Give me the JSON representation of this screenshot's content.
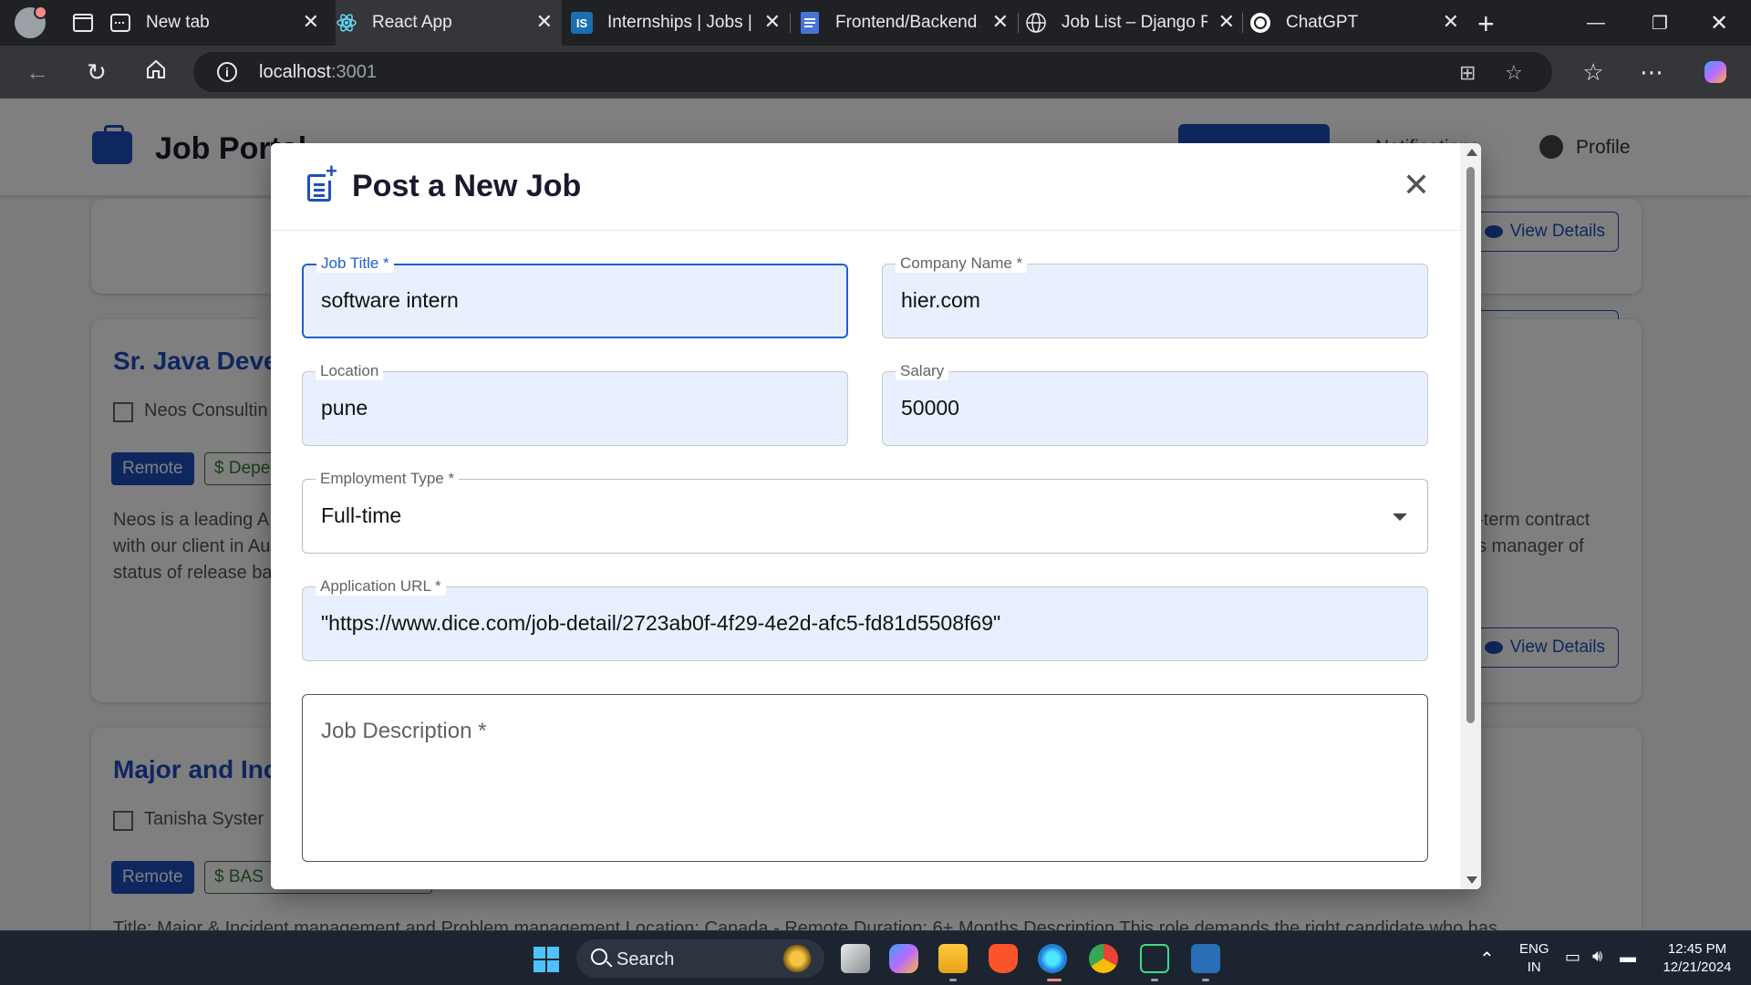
{
  "browser": {
    "tabs": [
      {
        "title": "New tab",
        "icon": "new-tab-icon"
      },
      {
        "title": "React App",
        "icon": "react-icon"
      },
      {
        "title": "Internships | Jobs | T",
        "icon": "internshala-icon"
      },
      {
        "title": "Frontend/Backend A",
        "icon": "docs-icon"
      },
      {
        "title": "Job List – Django RE",
        "icon": "globe-icon"
      },
      {
        "title": "ChatGPT",
        "icon": "chatgpt-icon"
      }
    ],
    "url_host": "localhost",
    "url_port": ":3001",
    "icon_letters": "IS"
  },
  "app": {
    "brand": "Job Portal",
    "header_links": [
      "Notifications",
      "Profile"
    ]
  },
  "cards": [
    {
      "title": "Sr. Java Deve",
      "company": "Neos Consultin",
      "chip_remote": "Remote",
      "chip_salary": "$ Depe",
      "desc_left": [
        "Neos is a leading A",
        "with our client in Au",
        "status of release ba"
      ],
      "desc_right": [
        "-term contract",
        "s manager of"
      ],
      "view_label": "View Details"
    },
    {
      "title": "Major and Inc",
      "company": "Tanisha Syster",
      "chip_remote": "Remote",
      "chip_salary": "$ BAS",
      "desc_left": [
        "Title: Major & Incident management and Problem management Location: Canada - Remote Duration: 6+ Months Description This role demands the right candidate who has"
      ],
      "desc_right": [],
      "view_label": ""
    }
  ],
  "top_card_view_label": "View Details",
  "modal": {
    "title": "Post a New Job",
    "close_icon": "close-icon",
    "fields": {
      "job_title": {
        "label": "Job Title *",
        "value": "software intern"
      },
      "company_name": {
        "label": "Company Name *",
        "value": "hier.com"
      },
      "location": {
        "label": "Location",
        "value": "pune"
      },
      "salary": {
        "label": "Salary",
        "value": "50000"
      },
      "employment_type": {
        "label": "Employment Type *",
        "value": "Full-time"
      },
      "application_url": {
        "label": "Application URL *",
        "value": "\"https://www.dice.com/job-detail/2723ab0f-4f29-4e2d-afc5-fd81d5508f69\""
      },
      "job_description": {
        "placeholder": "Job Description *"
      }
    }
  },
  "taskbar": {
    "search": "Search",
    "lang_top": "ENG",
    "lang_bottom": "IN",
    "time": "12:45 PM",
    "date": "12/21/2024"
  },
  "colors": {
    "primary": "#1f4fbf",
    "autofill": "#e8f0fe",
    "focus": "#1f5fd1"
  }
}
